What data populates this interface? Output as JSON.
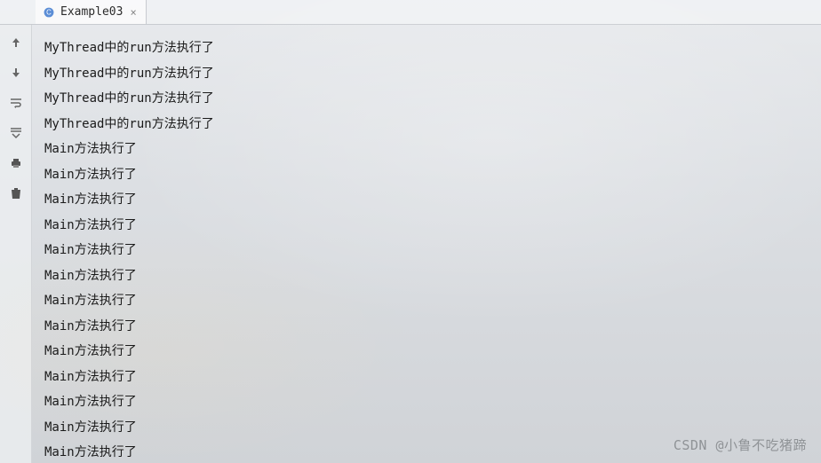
{
  "tab": {
    "label": "Example03",
    "close_glyph": "×"
  },
  "gutter": {
    "icons": [
      "arrow-up",
      "arrow-down",
      "wrap",
      "filter",
      "print",
      "trash"
    ]
  },
  "console": {
    "lines": [
      "MyThread中的run方法执行了",
      "MyThread中的run方法执行了",
      "MyThread中的run方法执行了",
      "MyThread中的run方法执行了",
      "Main方法执行了",
      "Main方法执行了",
      "Main方法执行了",
      "Main方法执行了",
      "Main方法执行了",
      "Main方法执行了",
      "Main方法执行了",
      "Main方法执行了",
      "Main方法执行了",
      "Main方法执行了",
      "Main方法执行了",
      "Main方法执行了",
      "Main方法执行了"
    ]
  },
  "watermark": "CSDN @小鲁不吃猪蹄"
}
